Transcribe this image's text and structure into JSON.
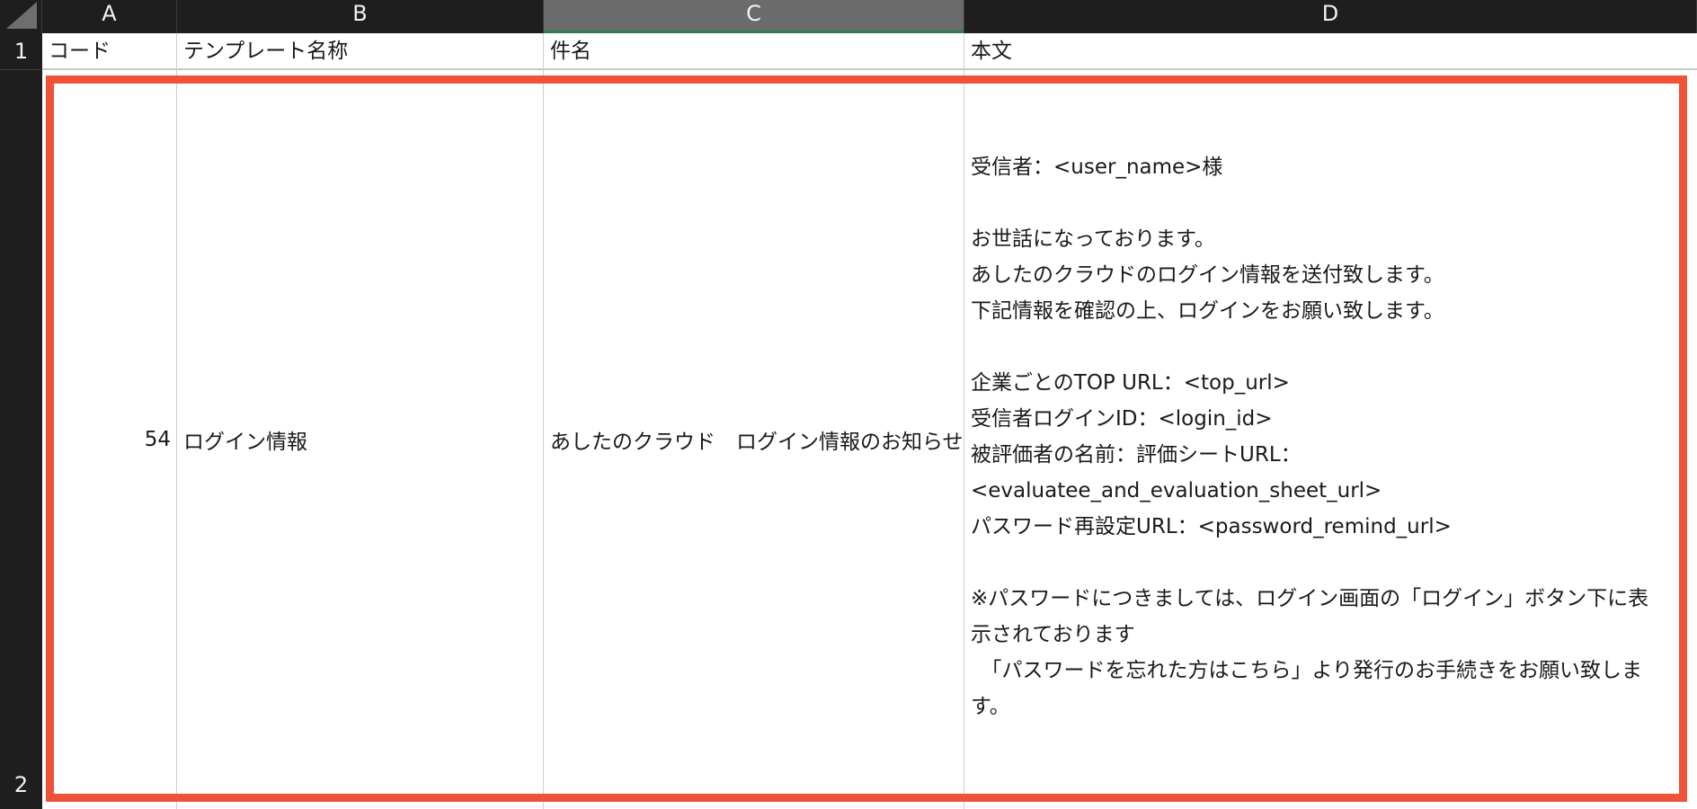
{
  "columns": [
    {
      "letter": "A"
    },
    {
      "letter": "B"
    },
    {
      "letter": "C",
      "selected": true
    },
    {
      "letter": "D"
    }
  ],
  "rows": [
    "1",
    "2"
  ],
  "header_row": {
    "code": "コード",
    "template_name": "テンプレート名称",
    "subject": "件名",
    "body": "本文"
  },
  "data_row": {
    "code": "54",
    "template_name": "ログイン情報",
    "subject": "あしたのクラウド　ログイン情報のお知らせ",
    "body_lines": [
      "受信者：<user_name>様",
      "",
      "お世話になっております。",
      "あしたのクラウドのログイン情報を送付致します。",
      "下記情報を確認の上、ログインをお願い致します。",
      "",
      "企業ごとのTOP URL：<top_url>",
      "受信者ログインID：<login_id>",
      "被評価者の名前：評価シートURL：",
      "<evaluatee_and_evaluation_sheet_url>",
      "パスワード再設定URL：<password_remind_url>",
      "",
      "※パスワードにつきましては、ログイン画面の「ログイン」ボタン下に表",
      "示されております",
      "　「パスワードを忘れた方はこちら」より発行のお手続きをお願い致しま",
      "す。"
    ]
  },
  "colors": {
    "header_bg": "#1e1e1e",
    "selected_header_bg": "#6b6b6b",
    "highlight_border": "#ef5337"
  }
}
